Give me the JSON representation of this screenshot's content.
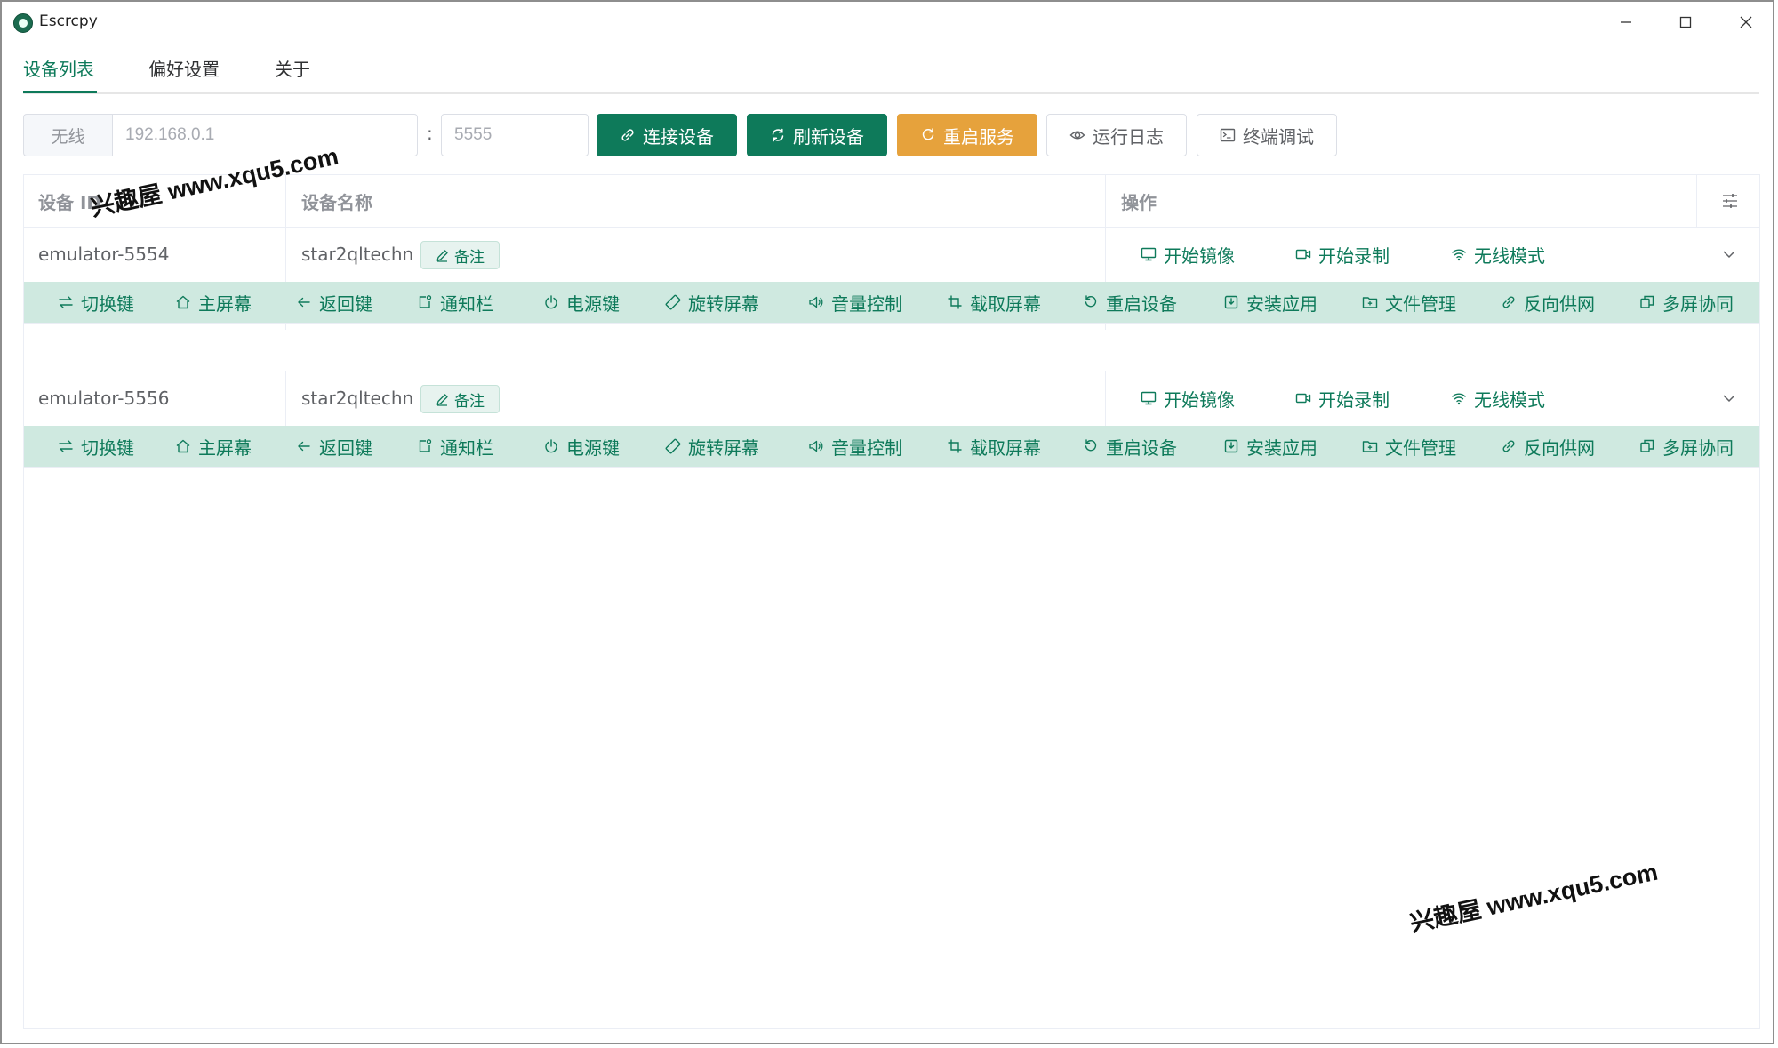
{
  "window": {
    "title": "Escrcpy"
  },
  "tabs": [
    {
      "label": "设备列表",
      "active": true
    },
    {
      "label": "偏好设置",
      "active": false
    },
    {
      "label": "关于",
      "active": false
    }
  ],
  "toolbar": {
    "prefix": "无线",
    "ip_placeholder": "192.168.0.1",
    "colon": ":",
    "port_placeholder": "5555",
    "connect_label": "连接设备",
    "refresh_label": "刷新设备",
    "restart_label": "重启服务",
    "log_label": "运行日志",
    "terminal_label": "终端调试"
  },
  "table": {
    "headers": {
      "device_id": "设备 ID",
      "device_name": "设备名称",
      "actions": "操作"
    },
    "remark_label": "备注",
    "row_actions": {
      "mirror": "开始镜像",
      "record": "开始录制",
      "wireless": "无线模式"
    },
    "controls": [
      "切换键",
      "主屏幕",
      "返回键",
      "通知栏",
      "电源键",
      "旋转屏幕",
      "音量控制",
      "截取屏幕",
      "重启设备",
      "安装应用",
      "文件管理",
      "反向供网",
      "多屏协同"
    ],
    "rows": [
      {
        "id": "emulator-5554",
        "name": "star2qltechn"
      },
      {
        "id": "emulator-5556",
        "name": "star2qltechn"
      }
    ]
  },
  "watermark": {
    "text": "兴趣屋 www.xqu5.com"
  },
  "colors": {
    "primary": "#0e7a5a",
    "warning": "#e6a23c",
    "action_bar": "#cfe9e0"
  }
}
